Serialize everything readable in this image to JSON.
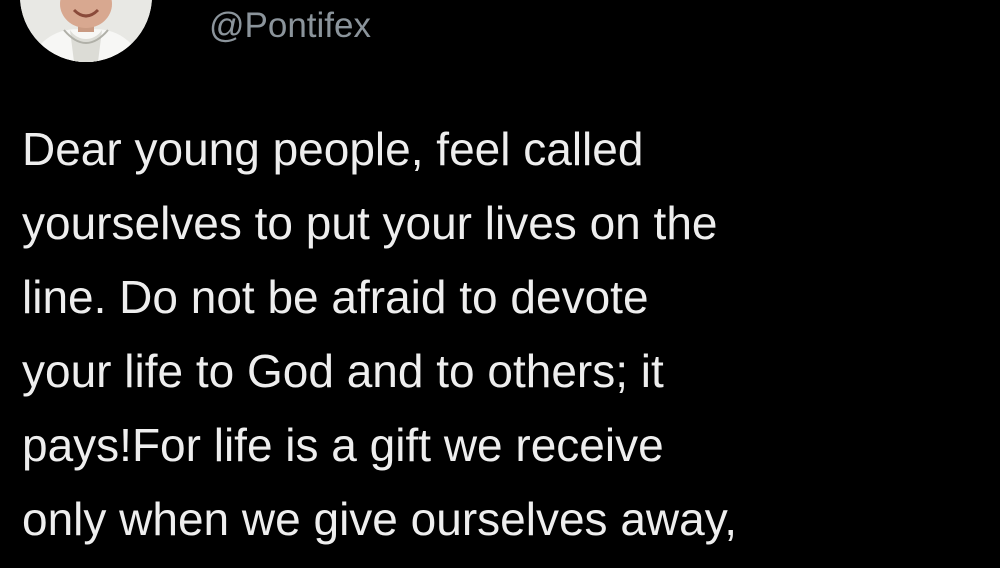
{
  "tweet": {
    "handle": "@Pontifex",
    "text_lines": [
      "Dear young people, feel called",
      "yourselves to put your lives on the",
      "line. Do not be afraid to devote",
      "your life to God and to others; it",
      "pays!For life is a gift we receive",
      "only when we give ourselves away,"
    ]
  },
  "colors": {
    "background": "#000000",
    "text": "#eeeeee",
    "handle": "#8b949b"
  },
  "icons": {
    "avatar": "profile-photo"
  }
}
